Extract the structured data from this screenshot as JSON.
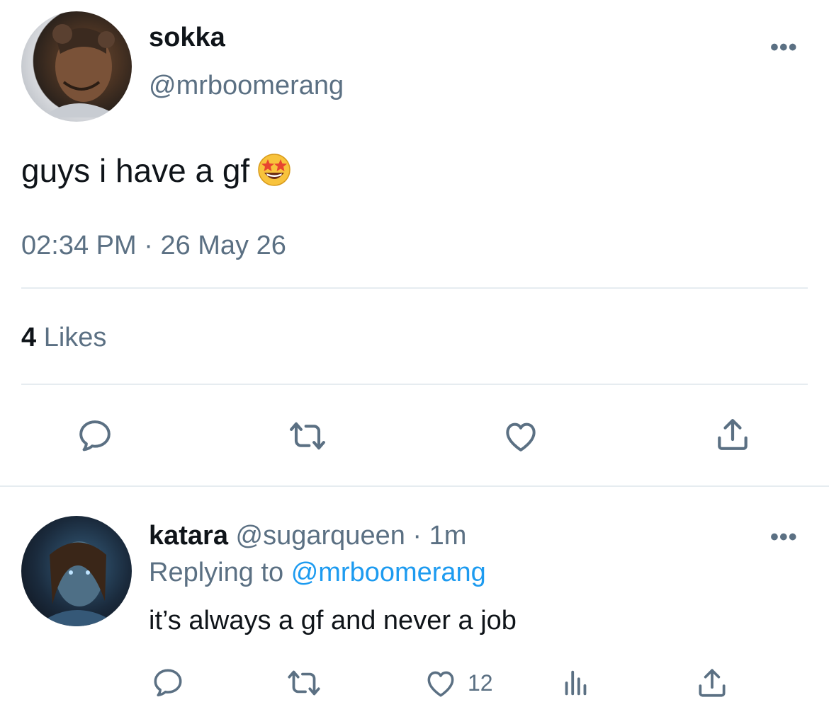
{
  "main_tweet": {
    "display_name": "sokka",
    "handle": "@mrboomerang",
    "text": "guys i have a gf",
    "emoji": "star-struck-emoji",
    "time": "02:34 PM",
    "date_separator": "·",
    "date": "26 May 26",
    "likes_count": "4",
    "likes_label": "Likes",
    "actions": [
      "reply-icon",
      "retweet-icon",
      "heart-icon",
      "share-icon"
    ]
  },
  "reply": {
    "display_name": "katara",
    "handle": "@sugarqueen",
    "separator": "·",
    "time_ago": "1m",
    "replying_to_label": "Replying to",
    "replying_to_handle": "@mrboomerang",
    "text": "it’s always a gf and never a job",
    "like_count": "12",
    "actions": [
      "reply-icon",
      "retweet-icon",
      "heart-icon",
      "analytics-icon",
      "share-icon"
    ]
  },
  "colors": {
    "text": "#0f1419",
    "muted": "#5b7083",
    "link": "#1d9bf0",
    "divider": "#e6ecf0"
  }
}
